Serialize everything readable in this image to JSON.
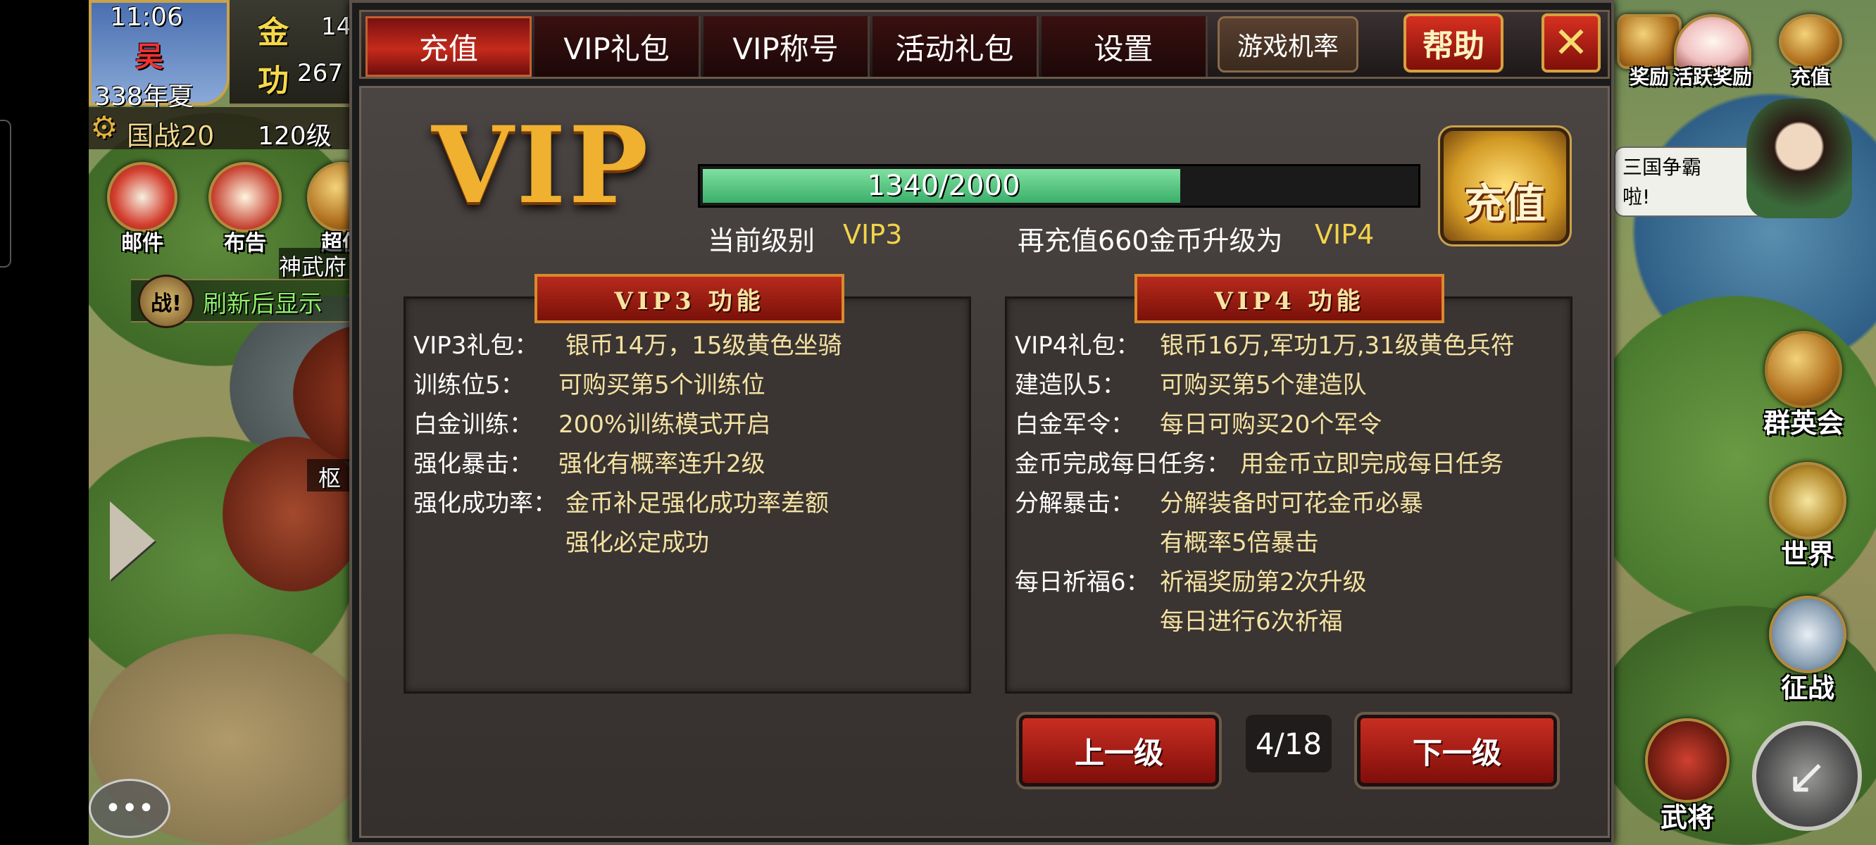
{
  "status": {
    "time": "11:06",
    "kingdom": "吴",
    "season": "338年夏",
    "gold_label": "金",
    "gold_value": "14",
    "merit_label": "功",
    "merit_value": "267",
    "war": "国战20",
    "level": "120级"
  },
  "left_icons": {
    "mail": "邮件",
    "notice": "布告",
    "super": "超值",
    "place": "神武府",
    "refresh": "刷新后显示",
    "battle_tag": "战!",
    "hub": "枢"
  },
  "right_icons": {
    "reward": "奖励",
    "active_reward": "活跃奖励",
    "recharge": "充值",
    "chat_line1": "三国争霸",
    "chat_line2": "啦!",
    "heroes": "群英会",
    "world": "世界",
    "conquest": "征战",
    "generals": "武将"
  },
  "tabs": [
    {
      "label": "充值"
    },
    {
      "label": "VIP礼包"
    },
    {
      "label": "VIP称号"
    },
    {
      "label": "活动礼包"
    },
    {
      "label": "设置"
    }
  ],
  "buttons": {
    "rates": "游戏机率",
    "help": "帮助",
    "close": "✕",
    "recharge": "充值",
    "prev": "上一级",
    "next": "下一级"
  },
  "vip": {
    "logo": "VIP",
    "progress_text": "1340/2000",
    "progress": 0.67,
    "current_label": "当前级别",
    "current_value": "VIP3",
    "upgrade_prefix": "再充值660金币升级为",
    "upgrade_target": "VIP4"
  },
  "page_indicator": "4/18",
  "left_box": {
    "title": "VIP3 功能",
    "rows": [
      {
        "k": "VIP3礼包：",
        "v": "银币14万，15级黄色坐骑"
      },
      {
        "k": "训练位5：",
        "v": "可购买第5个训练位"
      },
      {
        "k": "白金训练：",
        "v": "200%训练模式开启"
      },
      {
        "k": "强化暴击：",
        "v": "强化有概率连升2级"
      },
      {
        "k": "强化成功率：",
        "v": "金币补足强化成功率差额"
      },
      {
        "k": "",
        "v": "强化必定成功"
      }
    ]
  },
  "right_box": {
    "title": "VIP4 功能",
    "rows": [
      {
        "k": "VIP4礼包：",
        "v": "银币16万,军功1万,31级黄色兵符"
      },
      {
        "k": "建造队5：",
        "v": "可购买第5个建造队"
      },
      {
        "k": "白金军令：",
        "v": "每日可购买20个军令"
      },
      {
        "k": "金币完成每日任务：",
        "v": "用金币立即完成每日任务"
      },
      {
        "k": "分解暴击：",
        "v": "分解装备时可花金币必暴"
      },
      {
        "k": "",
        "v": "有概率5倍暴击"
      },
      {
        "k": "每日祈福6：",
        "v": "祈福奖励第2次升级"
      },
      {
        "k": "",
        "v": "每日进行6次祈福"
      }
    ]
  },
  "colors": {
    "accent_red": "#c52b1b",
    "gold_text": "#f2d44a",
    "progress_fill": "#4cc078"
  }
}
